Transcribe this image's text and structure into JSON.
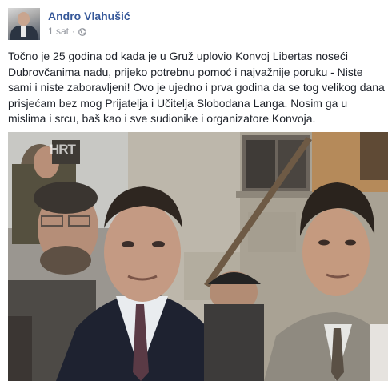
{
  "post": {
    "author": "Andro Vlahušić",
    "time": "1 sat",
    "separator": "·",
    "privacy_icon": "globe-icon",
    "text": "Točno je 25 godina od kada je u Gruž uplovio Konvoj Libertas noseći Dubrovčanima nadu, prijeko potrebnu pomoć i najvažnije poruku - Niste sami i niste zaboravljeni! Ovo je ujedno i prva godina da se tog velikog dana prisjećam bez mog Prijatelja i Učitelja Slobodana Langa. Nosim ga u mislima i srcu, baš kao i sve sudionike i organizatore Konvoja.",
    "photo": {
      "watermark": "HRT"
    }
  },
  "colors": {
    "author_link": "#365899",
    "meta_grey": "#90949c",
    "text": "#1d2129"
  }
}
